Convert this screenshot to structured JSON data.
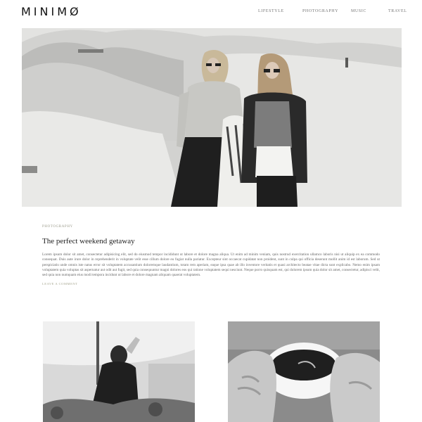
{
  "site": {
    "logo": "MINIMØ"
  },
  "nav": [
    {
      "label": "LIFESTYLE"
    },
    {
      "label": "PHOTOGRAPHY"
    },
    {
      "label": "MUSIC"
    },
    {
      "label": "TRAVEL"
    }
  ],
  "post": {
    "category": "PHOTOGRAPHY",
    "title": "The perfect weekend getaway",
    "excerpt": "Lorem ipsum dolor sit amet, consectetur adipisicing elit, sed do eiusmod tempor incididunt ut labore et dolore magna aliqua. Ut enim ad minim veniam, quis nostrud exercitation ullamco laboris nisi ut aliquip ex ea commodo consequat. Duis aute irure dolor in reprehenderit in voluptate velit esse cillum dolore eu fugiat nulla pariatur. Excepteur sint occaecat cupidatat non proident, sunt in culpa qui officia deserunt mollit anim id est laborum. Sed ut perspiciatis unde omnis iste natus error sit voluptatem accusantium doloremque laudantium, totam rem aperiam, eaque ipsa quae ab illo inventore veritatis et quasi architecto beatae vitae dicta sunt explicabo. Nemo enim ipsam voluptatem quia voluptas sit aspernatur aut odit aut fugit, sed quia consequuntur magni dolores eos qui ratione voluptatem sequi nesciunt. Neque porro quisquam est, qui dolorem ipsum quia dolor sit amet, consectetur, adipisci velit, sed quia non numquam eius modi tempora incidunt ut labore et dolore magnam aliquam quaerat voluptatem.",
    "comment_link": "LEAVE A COMMENT"
  }
}
